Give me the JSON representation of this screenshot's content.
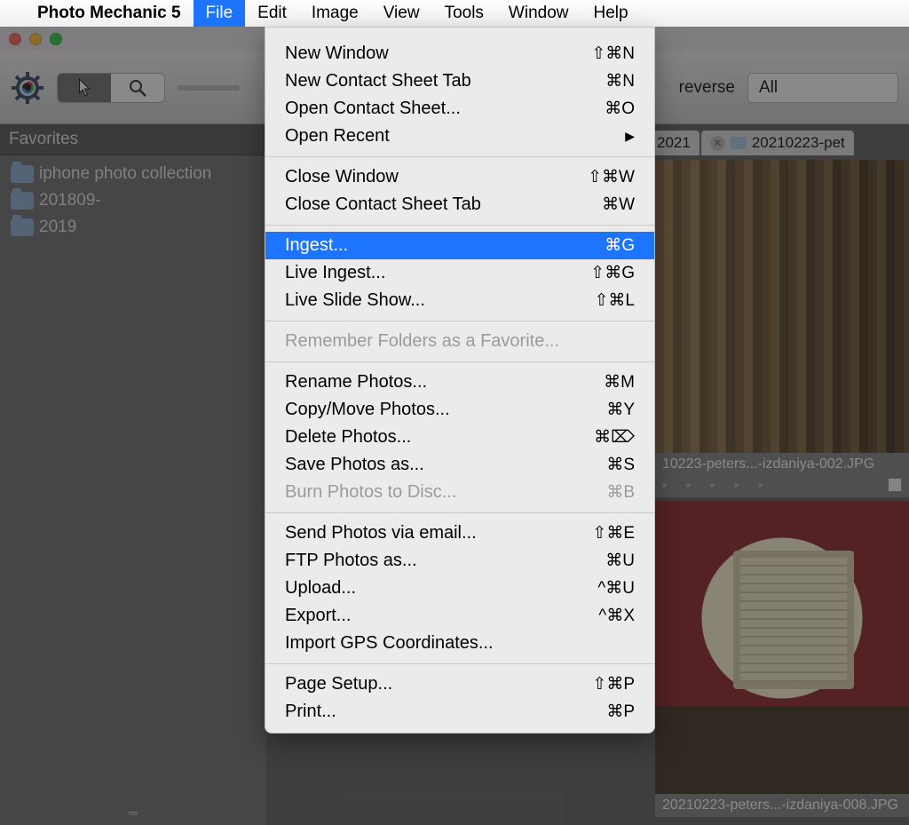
{
  "menubar": {
    "app_name": "Photo Mechanic 5",
    "items": [
      "File",
      "Edit",
      "Image",
      "View",
      "Tools",
      "Window",
      "Help"
    ],
    "selected_index": 0
  },
  "toolbar": {
    "reverse_label": "reverse",
    "filter_value": "All"
  },
  "tabs": {
    "tab1_label": "2021",
    "tab2_label": "20210223-pet"
  },
  "sidebar": {
    "title": "Favorites",
    "items": [
      {
        "label": "iphone photo collection"
      },
      {
        "label": "201809-"
      },
      {
        "label": "2019"
      }
    ]
  },
  "thumbnails": {
    "t1_caption": "10223-peters...-izdaniya-002.JPG",
    "t2_caption": "20210223-peters...-izdaniya-008.JPG"
  },
  "file_menu": {
    "sections": [
      [
        {
          "label": "New Window",
          "shortcut": "⇧⌘N"
        },
        {
          "label": "New Contact Sheet Tab",
          "shortcut": "⌘N"
        },
        {
          "label": "Open Contact Sheet...",
          "shortcut": "⌘O"
        },
        {
          "label": "Open Recent",
          "submenu": true
        }
      ],
      [
        {
          "label": "Close Window",
          "shortcut": "⇧⌘W"
        },
        {
          "label": "Close Contact Sheet Tab",
          "shortcut": "⌘W"
        }
      ],
      [
        {
          "label": "Ingest...",
          "shortcut": "⌘G",
          "highlight": true
        },
        {
          "label": "Live Ingest...",
          "shortcut": "⇧⌘G"
        },
        {
          "label": "Live Slide Show...",
          "shortcut": "⇧⌘L"
        }
      ],
      [
        {
          "label": "Remember Folders as a Favorite...",
          "disabled": true
        }
      ],
      [
        {
          "label": "Rename Photos...",
          "shortcut": "⌘M"
        },
        {
          "label": "Copy/Move Photos...",
          "shortcut": "⌘Y"
        },
        {
          "label": "Delete Photos...",
          "shortcut": "⌘⌦"
        },
        {
          "label": "Save Photos as...",
          "shortcut": "⌘S"
        },
        {
          "label": "Burn Photos to Disc...",
          "shortcut": "⌘B",
          "disabled": true
        }
      ],
      [
        {
          "label": "Send Photos via email...",
          "shortcut": "⇧⌘E"
        },
        {
          "label": "FTP Photos as...",
          "shortcut": "⌘U"
        },
        {
          "label": "Upload...",
          "shortcut": "^⌘U"
        },
        {
          "label": "Export...",
          "shortcut": "^⌘X"
        },
        {
          "label": "Import GPS Coordinates..."
        }
      ],
      [
        {
          "label": "Page Setup...",
          "shortcut": "⇧⌘P"
        },
        {
          "label": "Print...",
          "shortcut": "⌘P"
        }
      ]
    ]
  }
}
